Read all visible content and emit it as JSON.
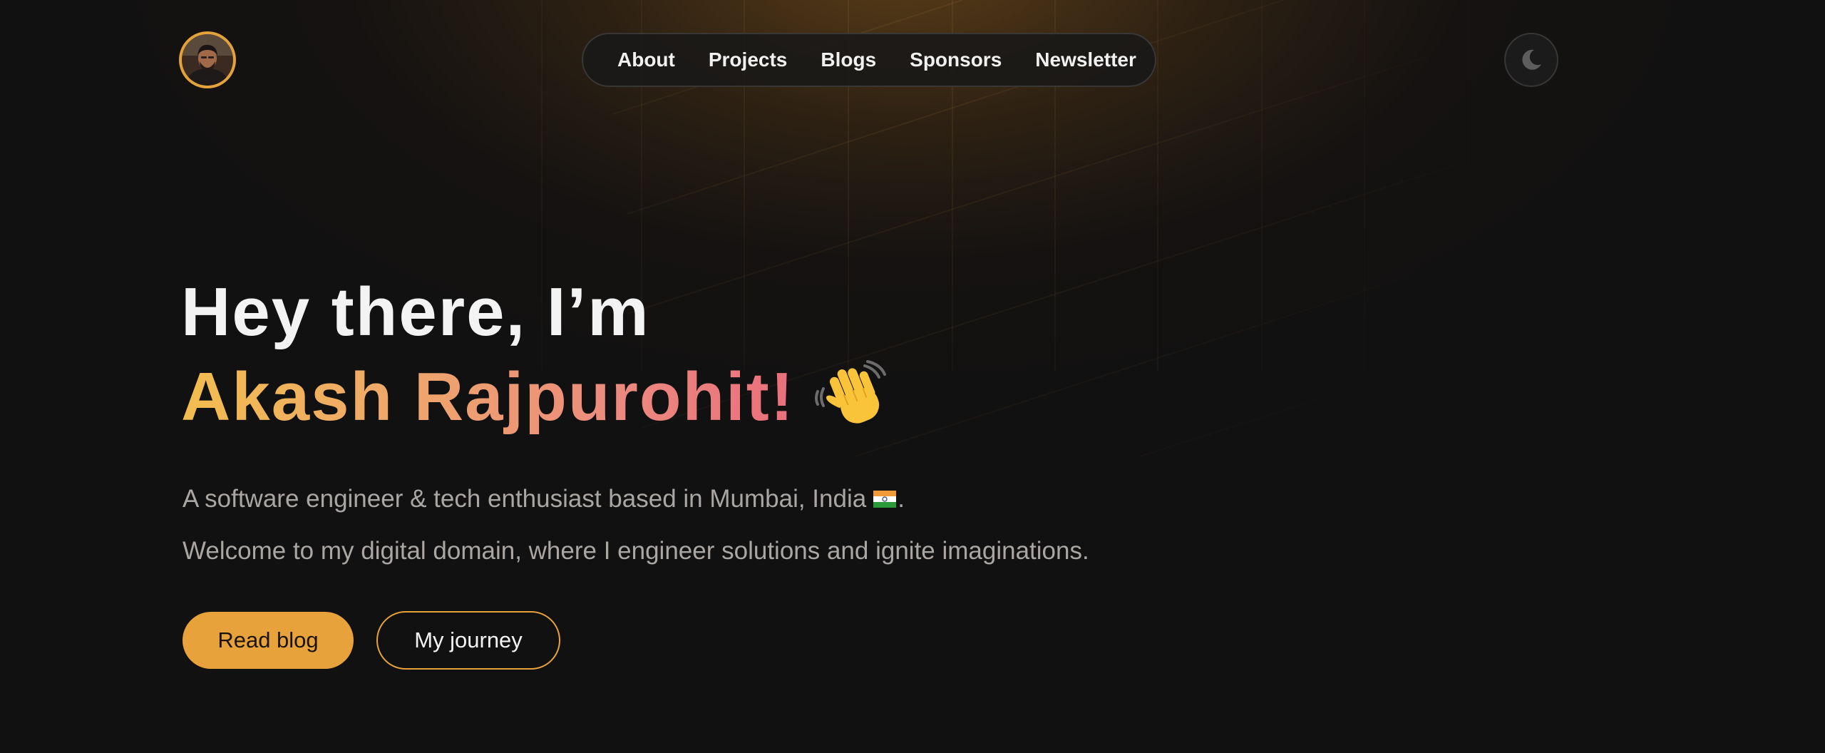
{
  "header": {
    "avatar_icon": "avatar-photo",
    "nav": [
      {
        "label": "About"
      },
      {
        "label": "Projects"
      },
      {
        "label": "Blogs"
      },
      {
        "label": "Sponsors"
      },
      {
        "label": "Newsletter"
      }
    ],
    "theme_toggle_icon": "moon-icon"
  },
  "hero": {
    "greeting": "Hey there, I’m",
    "name": "Akash Rajpurohit!",
    "wave_icon": "waving-hand-icon",
    "tagline_before_flag": "A software engineer & tech enthusiast based in Mumbai, India",
    "flag_icon": "india-flag-icon",
    "tagline_after_flag": ".",
    "welcome": "Welcome to my digital domain, where I engineer solutions and ignite imaginations.",
    "primary_button": "Read blog",
    "secondary_button": "My journey"
  },
  "colors": {
    "background": "#121111",
    "accent": "#e8a23b",
    "name_gradient_start": "#f2bd4e",
    "name_gradient_end": "#e96f7c",
    "body_text": "#a9a6a3"
  }
}
